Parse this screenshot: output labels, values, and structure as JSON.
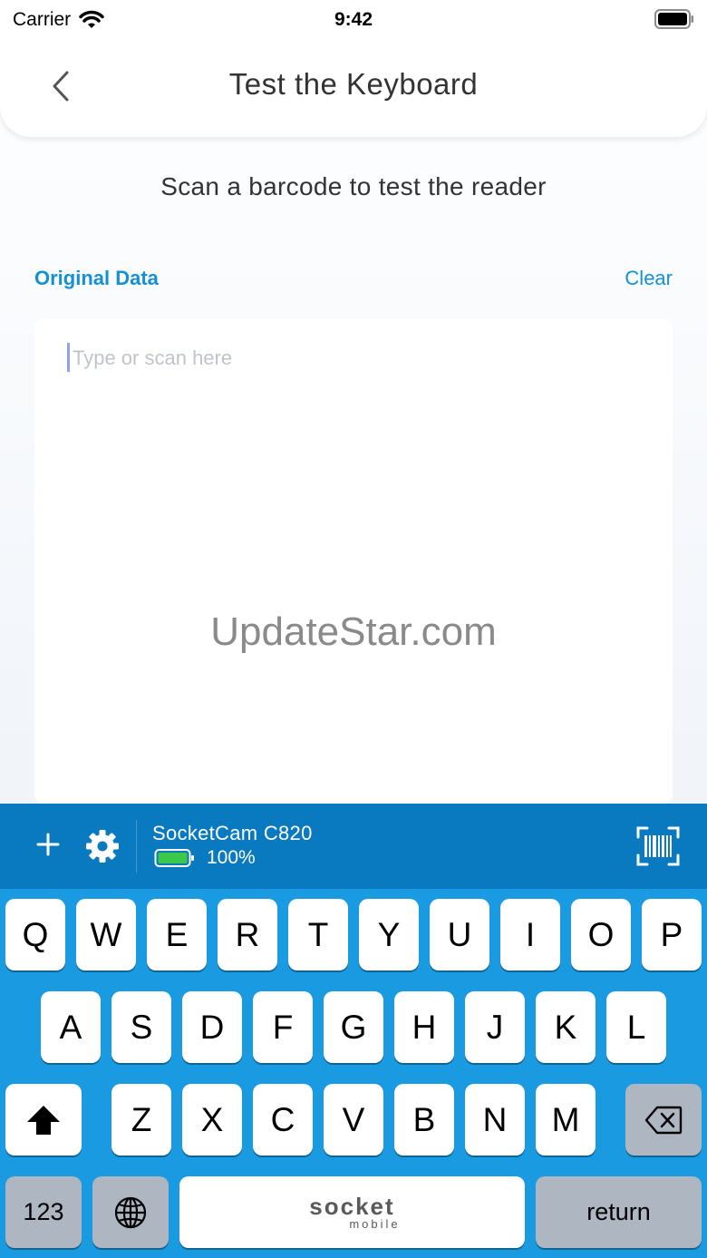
{
  "status": {
    "carrier": "Carrier",
    "time": "9:42"
  },
  "header": {
    "title": "Test the Keyboard"
  },
  "subtitle": "Scan a barcode to test the reader",
  "section": {
    "label": "Original Data",
    "clear": "Clear"
  },
  "input": {
    "placeholder": "Type or scan here",
    "value": ""
  },
  "watermark": "UpdateStar.com",
  "toolbar": {
    "device_name": "SocketCam C820",
    "battery_pct": "100%",
    "battery_level": 1.0
  },
  "keyboard": {
    "row1": [
      "Q",
      "W",
      "E",
      "R",
      "T",
      "Y",
      "U",
      "I",
      "O",
      "P"
    ],
    "row2": [
      "A",
      "S",
      "D",
      "F",
      "G",
      "H",
      "J",
      "K",
      "L"
    ],
    "row3": [
      "Z",
      "X",
      "C",
      "V",
      "B",
      "N",
      "M"
    ],
    "numbers_key": "123",
    "return_key": "return",
    "space_logo_top": "socket",
    "space_logo_bottom": "mobile"
  },
  "colors": {
    "accent": "#1590d4",
    "toolbar": "#0a7ac0",
    "keyboard": "#1a9ae0",
    "battery": "#3cc84a"
  }
}
